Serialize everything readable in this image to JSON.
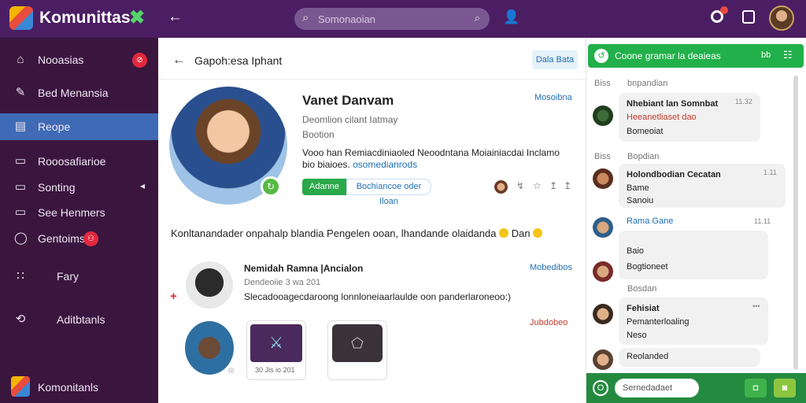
{
  "topbar": {
    "app_title": "Komunittas",
    "logo_x_icon": "✖",
    "back_icon": "←",
    "search": {
      "placeholder": "Somonaoian",
      "icon": "⌕",
      "trail_icon": "⌕"
    },
    "user_icon": "👤"
  },
  "sidebar": {
    "items": [
      {
        "label": "Nooasias",
        "icon": "⌂",
        "badge": "⊘"
      },
      {
        "label": "Bed Menansia",
        "icon": "✎"
      },
      {
        "label": "Reope",
        "icon": "▤"
      },
      {
        "label": "Rooosafiarioe",
        "icon": "▭"
      },
      {
        "label": "Sonting",
        "icon": "▭",
        "chevron": "◂"
      },
      {
        "label": "See Henmers",
        "icon": "▭"
      },
      {
        "label": "Gentoims",
        "icon": "◯",
        "badge": "⚇"
      },
      {
        "label": "Fary",
        "icon": "∷"
      },
      {
        "label": "Aditbtanls",
        "icon": "⟲"
      }
    ],
    "bottom_label": "Komonitanls"
  },
  "main": {
    "back_icon": "←",
    "title": "Gapoh:esa Iphant",
    "header_button": "Dala Bata",
    "profile": {
      "badge_icon": "↻",
      "name": "Vanet Danvam",
      "follow_link": "Mosoibna",
      "subtitle": "Deomlion cilant Iatmay",
      "subtitle2": "Bootion",
      "bio_text": "Vooo han Remiacdiniaoled Neoodntana Moiainiacdai Inclamo bio biaioes.",
      "bio_link": "osomedianrods",
      "chip_a": "Adanne",
      "chip_b": "Bochiancoe oder Iloan",
      "actions": [
        "↯",
        "☆",
        "↥",
        "↥"
      ]
    },
    "post_text": "Konltanandader onpahalp blandia Pengelen ooan, lhandande olaidanda",
    "post_tail": "Dan",
    "comment": {
      "plus_icon": "+",
      "name": "Nemidah Ramna |Ancialon",
      "link": "Mobedibos",
      "meta": "Dendeoiie 3 wa 201",
      "text": "Slecadooagecdaroong lonnloneiaarlaulde oon panderlaroneoo:)",
      "thumb1_caption": "30 Jis io 201",
      "thumb1_icon": "⚔",
      "thumb2_icon": "⬠",
      "link2": "Jubdobeo",
      "avatar2_dot": "◎"
    }
  },
  "chat": {
    "title": "Coone gramar la deaieas",
    "title_icon": "↺",
    "header_t1": "bb",
    "header_t2": "☷",
    "sections": [
      {
        "left": "Biss",
        "right": "bnpandian"
      },
      {
        "left": "Biss",
        "right": "Bopdian"
      }
    ],
    "messages": [
      {
        "lines": [
          "Nhebiant lan Somnbat",
          "Heeanetliaset dao",
          "Bomeoiat"
        ],
        "time": "11.32"
      },
      {
        "lines": [
          "Holondbodian Cecatan",
          "Bame",
          "Sanoiu"
        ],
        "time": "1.11"
      },
      {
        "lines": [
          "Rama Gane"
        ],
        "time": "11.11"
      },
      {
        "lines": [
          "Baio",
          "Bogtioneet"
        ],
        "time": ""
      },
      {
        "section": "Bosdan"
      },
      {
        "lines": [
          "Fehisiat",
          "Pemanterloaling",
          "Neso"
        ],
        "time": "•••"
      },
      {
        "lines": [
          "Reolanded"
        ],
        "time": ""
      }
    ],
    "footer": {
      "left_icon": "O",
      "input_placeholder": "Sernedadaet",
      "btn1": "◘",
      "btn2": "◙"
    }
  }
}
